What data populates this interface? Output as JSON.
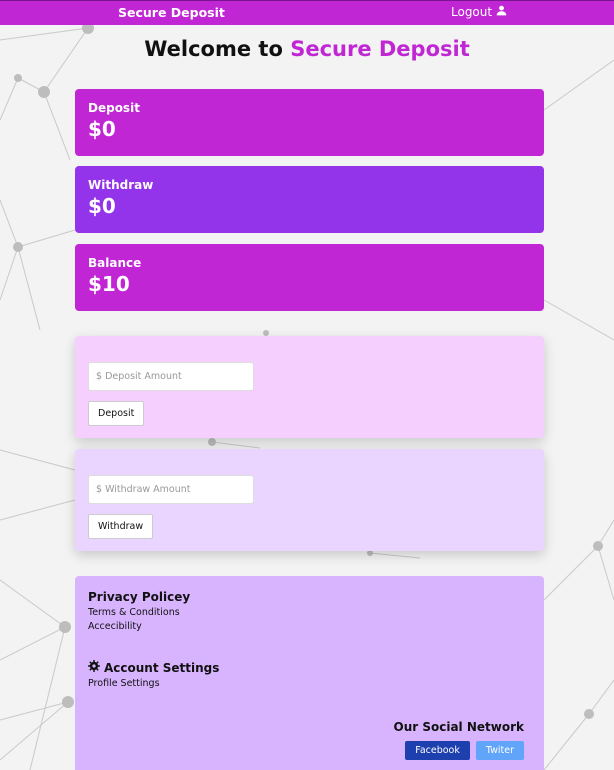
{
  "navbar": {
    "brand": "Secure Deposit",
    "logout_label": "Logout",
    "logout_icon": "user-icon",
    "color": "#c026d3"
  },
  "heading": {
    "prefix": "Welcome to",
    "accent": "Secure Deposit",
    "accent_color": "#c026d3"
  },
  "stats": {
    "deposit": {
      "label": "Deposit",
      "value": "$0",
      "color": "#c026d3"
    },
    "withdraw": {
      "label": "Withdraw",
      "value": "$0",
      "color": "#9333ea"
    },
    "balance": {
      "label": "Balance",
      "value": "$10",
      "color": "#c026d3"
    }
  },
  "deposit_form": {
    "placeholder": "$ Deposit Amount",
    "value": "",
    "button_label": "Deposit",
    "color": "#f5d0fe"
  },
  "withdraw_form": {
    "placeholder": "$ Withdraw Amount",
    "value": "",
    "button_label": "Withdraw",
    "color": "#e9d5ff"
  },
  "footer": {
    "color": "#d8b4fe",
    "privacy_heading": "Privacy Policey",
    "links": [
      "Terms & Conditions",
      "Accecibility"
    ],
    "account_heading": "Account Settings",
    "account_icon": "gear-icon",
    "account_links": [
      "Profile Settings"
    ],
    "social_heading": "Our Social Network",
    "social_buttons": [
      {
        "label": "Facebook",
        "color": "#1e40af"
      },
      {
        "label": "Twiter",
        "color": "#60a5fa"
      }
    ]
  }
}
